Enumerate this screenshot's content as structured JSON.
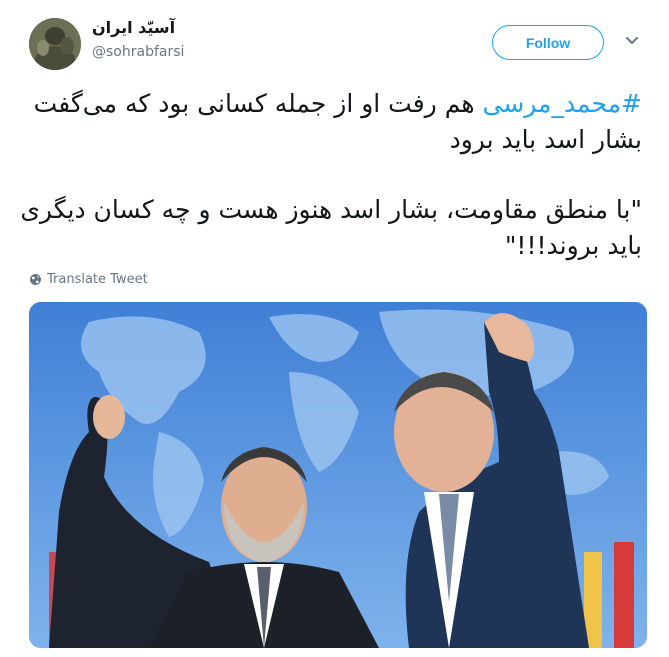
{
  "author": {
    "display_name": "آسیّد ایران",
    "handle": "@sohrabfarsi"
  },
  "follow_button": {
    "label": "Follow"
  },
  "tweet": {
    "hashtag": "#محمد_مرسی",
    "line1_rest": " هم رفت او از جمله کسانی بود که می‌گفت",
    "line2": "بشار اسد باید برود",
    "line3": "\"با منطق مقاومت، بشار اسد هنوز هست و چه کسان دیگری",
    "line4": "باید بروند!!!\""
  },
  "translate": {
    "label": "Translate Tweet",
    "icon": "globe-icon"
  },
  "media": {
    "icon": "photo"
  },
  "colors": {
    "accent": "#1da1f2",
    "secondary_text": "#657786",
    "text": "#14171a"
  }
}
